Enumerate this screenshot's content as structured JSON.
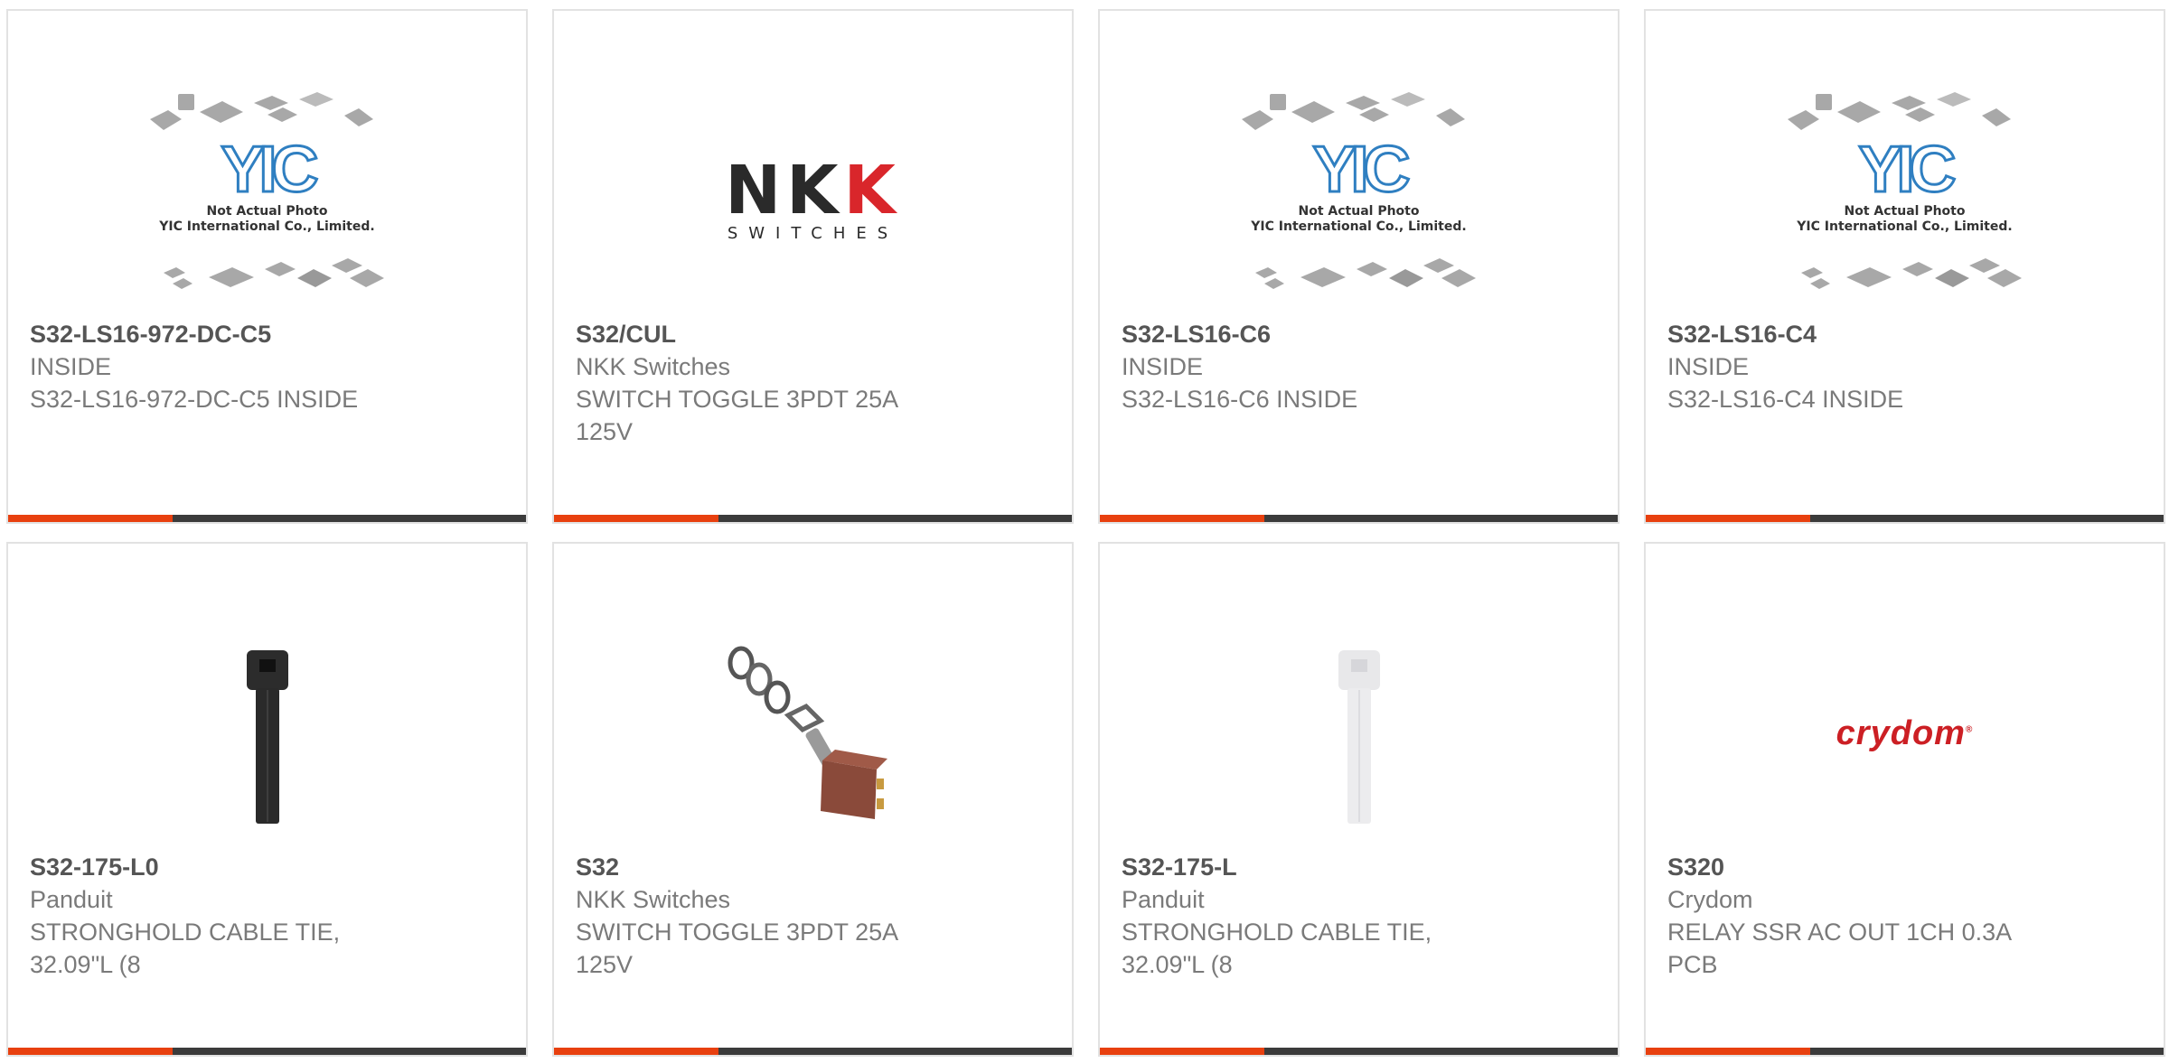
{
  "colors": {
    "accent": "#e8400f",
    "bar": "#3b3b3b",
    "border": "#e2e2e2",
    "part_number": "#555555",
    "muted_text": "#7a7a7a"
  },
  "placeholder": {
    "brand": "YIC",
    "caption_line1": "Not Actual Photo",
    "caption_line2": "YIC International Co., Limited."
  },
  "logos": {
    "nkk_word_dark": "NK",
    "nkk_word_red": "K",
    "nkk_sub": "SWITCHES",
    "crydom": "crydom"
  },
  "products": [
    {
      "part_number": "S32-LS16-972-DC-C5",
      "manufacturer": "INSIDE",
      "description": "S32-LS16-972-DC-C5 INSIDE",
      "image": "yic-placeholder"
    },
    {
      "part_number": "S32/CUL",
      "manufacturer": "NKK Switches",
      "description": "SWITCH TOGGLE 3PDT 25A 125V",
      "image": "nkk-logo"
    },
    {
      "part_number": "S32-LS16-C6",
      "manufacturer": "INSIDE",
      "description": "S32-LS16-C6 INSIDE",
      "image": "yic-placeholder"
    },
    {
      "part_number": "S32-LS16-C4",
      "manufacturer": "INSIDE",
      "description": "S32-LS16-C4 INSIDE",
      "image": "yic-placeholder"
    },
    {
      "part_number": "S32-175-L0",
      "manufacturer": "Panduit",
      "description": "STRONGHOLD CABLE TIE, 32.09\"L (8",
      "image": "black-cable-tie"
    },
    {
      "part_number": "S32",
      "manufacturer": "NKK Switches",
      "description": "SWITCH TOGGLE 3PDT 25A 125V",
      "image": "toggle-switch-photo"
    },
    {
      "part_number": "S32-175-L",
      "manufacturer": "Panduit",
      "description": "STRONGHOLD CABLE TIE, 32.09\"L (8",
      "image": "natural-cable-tie"
    },
    {
      "part_number": "S320",
      "manufacturer": "Crydom",
      "description": "RELAY SSR AC OUT 1CH 0.3A PCB",
      "image": "crydom-logo"
    }
  ]
}
